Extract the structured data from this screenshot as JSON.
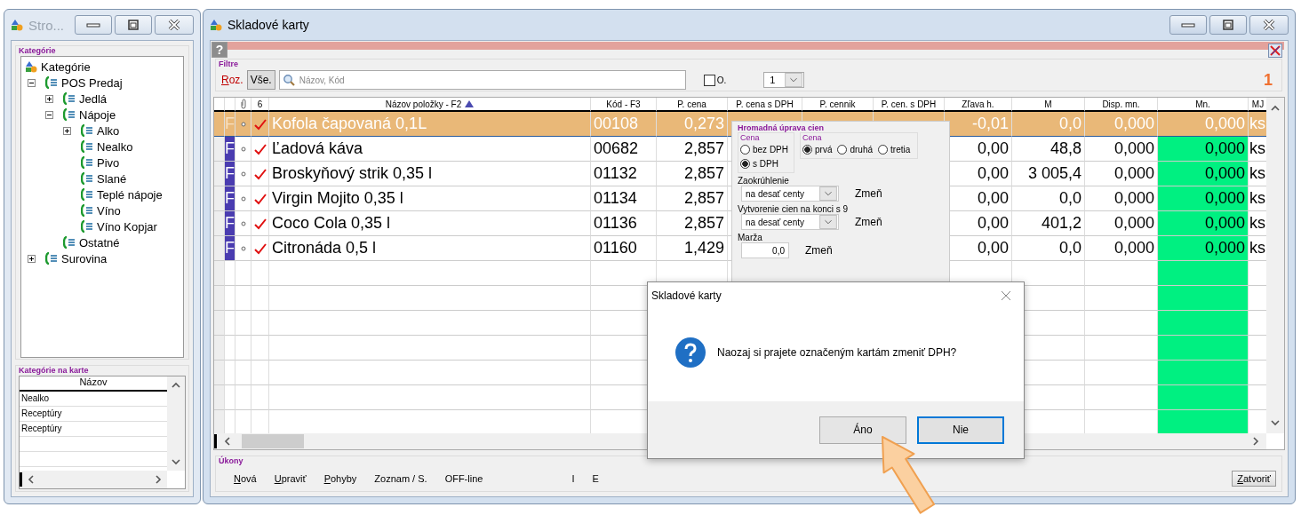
{
  "side_window": {
    "title": "Stro...",
    "categories": {
      "legend": "Kategórie",
      "tree": [
        {
          "label": "Kategórie",
          "kind": "root",
          "children": [
            {
              "label": "POS Predaj",
              "kind": "group",
              "expanded": true,
              "children": [
                {
                  "label": "Jedlá",
                  "kind": "group",
                  "expanded": false
                },
                {
                  "label": "Nápoje",
                  "kind": "group",
                  "expanded": true,
                  "children": [
                    {
                      "label": "Alko",
                      "kind": "group",
                      "expanded": false
                    },
                    {
                      "label": "Nealko",
                      "kind": "leaf"
                    },
                    {
                      "label": "Pivo",
                      "kind": "leaf"
                    },
                    {
                      "label": "Slané",
                      "kind": "leaf"
                    },
                    {
                      "label": "Teplé nápoje",
                      "kind": "leaf"
                    },
                    {
                      "label": "Víno",
                      "kind": "leaf"
                    },
                    {
                      "label": "Víno Kopjar",
                      "kind": "leaf"
                    }
                  ]
                },
                {
                  "label": "Ostatné",
                  "kind": "leaf"
                }
              ]
            },
            {
              "label": "Surovina",
              "kind": "group",
              "expanded": false
            }
          ]
        }
      ]
    },
    "card_categories": {
      "legend": "Kategórie na karte",
      "column": "Názov",
      "rows": [
        "Nealko",
        "Receptúry",
        "Receptúry"
      ]
    }
  },
  "main_window": {
    "title": "Skladové karty",
    "help_button": "?",
    "filter": {
      "legend": "Filtre",
      "expand_link": {
        "label": "Roz.",
        "mnemonic": true
      },
      "all_button": "Vše.",
      "search": {
        "placeholder": "Názov, Kód"
      },
      "option": {
        "label": "O.",
        "checked": false
      },
      "page_select": "1",
      "count": "1"
    },
    "table": {
      "columns": [
        {
          "label": "6"
        },
        {
          "label": "Názov položky - F2",
          "sorted": true
        },
        {
          "label": "Kód - F3"
        },
        {
          "label": "P. cena"
        },
        {
          "label": "P. cena s DPH"
        },
        {
          "label": "P. cennik"
        },
        {
          "label": "P. cen. s DPH"
        },
        {
          "label": "Zľava h."
        },
        {
          "label": "M"
        },
        {
          "label": "Disp. mn."
        },
        {
          "label": "Mn."
        },
        {
          "label": "MJ"
        }
      ],
      "rows": [
        {
          "selected": true,
          "flag": "F",
          "checked": true,
          "name": "Kofola čapovaná 0,1L",
          "code": "00108",
          "price": "0,273",
          "discount": "-0,01",
          "m": "0,0",
          "available": "0,000",
          "qty": "0,000",
          "unit": "ks"
        },
        {
          "selected": false,
          "flag": "F",
          "checked": true,
          "name": "Ľadová káva",
          "code": "00682",
          "price": "2,857",
          "discount": "0,00",
          "m": "48,8",
          "available": "0,000",
          "qty": "0,000",
          "unit": "ks"
        },
        {
          "selected": false,
          "flag": "F",
          "checked": true,
          "name": "Broskyňový strik 0,35 l",
          "code": "01132",
          "price": "2,857",
          "discount": "0,00",
          "m": "3 005,4",
          "available": "0,000",
          "qty": "0,000",
          "unit": "ks"
        },
        {
          "selected": false,
          "flag": "F",
          "checked": true,
          "name": "Virgin Mojito 0,35 l",
          "code": "01134",
          "price": "2,857",
          "discount": "0,00",
          "m": "0,0",
          "available": "0,000",
          "qty": "0,000",
          "unit": "ks"
        },
        {
          "selected": false,
          "flag": "F",
          "checked": true,
          "name": "Coco Cola 0,35 l",
          "code": "01136",
          "price": "2,857",
          "discount": "0,00",
          "m": "401,2",
          "available": "0,000",
          "qty": "0,000",
          "unit": "ks"
        },
        {
          "selected": false,
          "flag": "F",
          "checked": true,
          "name": "Citronáda 0,5 l",
          "code": "01160",
          "price": "1,429",
          "discount": "0,00",
          "m": "0,0",
          "available": "0,000",
          "qty": "0,000",
          "unit": "ks"
        }
      ]
    },
    "bulk_price_panel": {
      "title": "Hromadná úprava cien",
      "price_basis": {
        "legend": "Cena",
        "options": [
          {
            "label": "bez DPH",
            "selected": false
          },
          {
            "label": "s DPH",
            "selected": true
          }
        ]
      },
      "price_level": {
        "legend": "Cena",
        "options": [
          {
            "label": "prvá",
            "selected": true
          },
          {
            "label": "druhá",
            "selected": false
          },
          {
            "label": "tretia",
            "selected": false
          }
        ]
      },
      "rounding": {
        "label": "Zaokrúhlenie",
        "value": "na desať centy",
        "apply": "Zmeň"
      },
      "ending_nine": {
        "label": "Vytvorenie cien na konci s 9",
        "value": "na desať centy",
        "apply": "Zmeň"
      },
      "margin": {
        "label": "Marža",
        "value": "0,0",
        "apply": "Zmeň"
      }
    },
    "actions": {
      "legend": "Úkony",
      "buttons": [
        {
          "label": "Nová",
          "mnemonic": true
        },
        {
          "label": "Upraviť",
          "mnemonic": true
        },
        {
          "label": "Pohyby",
          "mnemonic": true
        },
        {
          "label": "Zoznam / S.",
          "mnemonic": false
        },
        {
          "label": "OFF-line",
          "mnemonic": false
        },
        {
          "label": "I",
          "mnemonic": false
        },
        {
          "label": "E",
          "mnemonic": false
        }
      ],
      "close_button": {
        "label": "Zatvoriť",
        "mnemonic": true
      }
    }
  },
  "dialog": {
    "title": "Skladové karty",
    "message": "Naozaj si prajete označeným kartám zmeniť DPH?",
    "buttons": [
      {
        "label": "Áno",
        "kind": "hovered"
      },
      {
        "label": "Nie",
        "kind": "default"
      }
    ]
  }
}
